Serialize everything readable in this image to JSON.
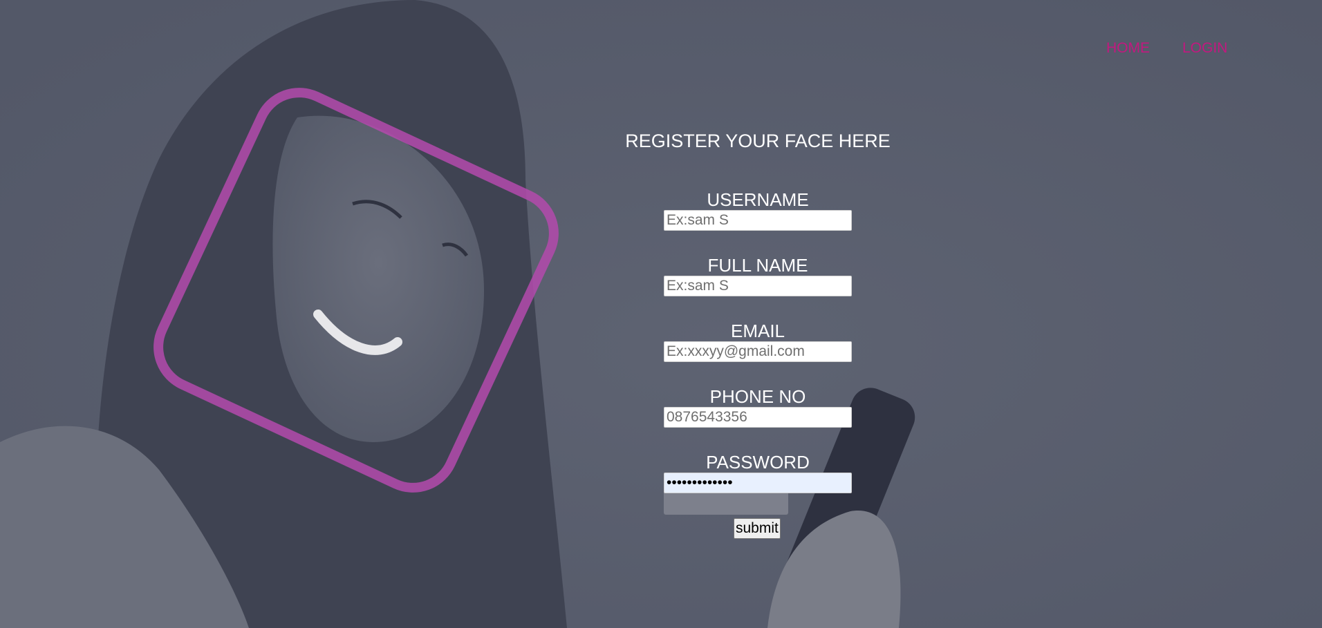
{
  "nav": {
    "home_label": "HOME",
    "login_label": "LOGIN"
  },
  "form": {
    "title": "REGISTER YOUR FACE HERE",
    "fields": [
      {
        "label": "USERNAME",
        "placeholder": "Ex:sam S",
        "value": ""
      },
      {
        "label": "FULL NAME",
        "placeholder": "Ex:sam S",
        "value": ""
      },
      {
        "label": "EMAIL",
        "placeholder": "Ex:xxxyy@gmail.com",
        "value": ""
      },
      {
        "label": "PHONE NO",
        "placeholder": "0876543356",
        "value": ""
      },
      {
        "label": "PASSWORD",
        "placeholder": "",
        "value": "•••••••••••••"
      }
    ],
    "submit_label": "submit"
  },
  "colors": {
    "accent": "#c2187f",
    "background_overlay": "#585d6c",
    "frame": "#b44aad"
  }
}
